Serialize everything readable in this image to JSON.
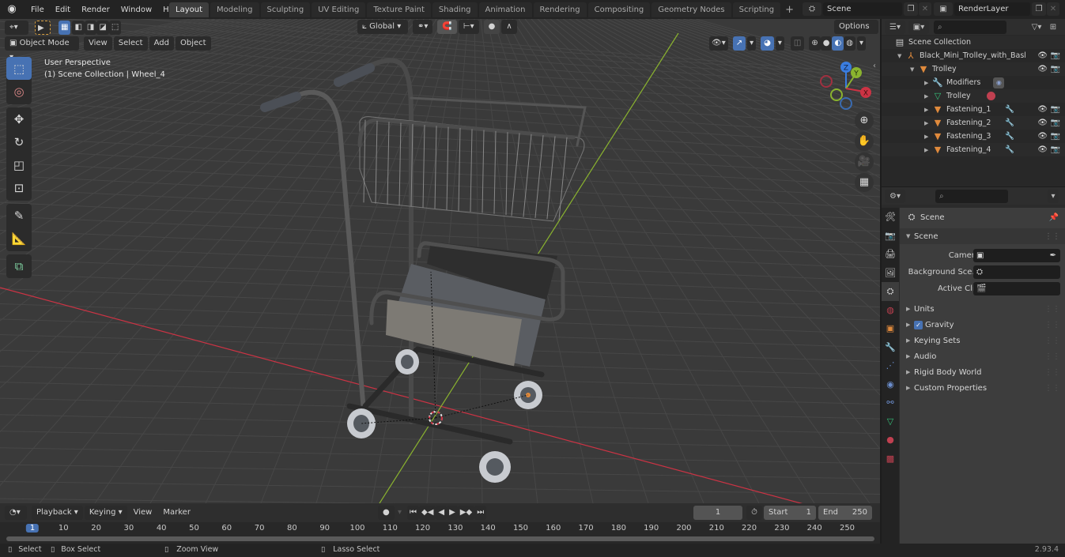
{
  "app": {
    "version": "2.93.4"
  },
  "menu": {
    "logo_icon": "blender-logo-icon",
    "items": [
      "File",
      "Edit",
      "Render",
      "Window",
      "Help"
    ]
  },
  "workspaces": {
    "tabs": [
      "Layout",
      "Modeling",
      "Sculpting",
      "UV Editing",
      "Texture Paint",
      "Shading",
      "Animation",
      "Rendering",
      "Compositing",
      "Geometry Nodes",
      "Scripting"
    ],
    "active": "Layout",
    "add_label": "+"
  },
  "scene_selector": {
    "value": "Scene"
  },
  "view_layer_selector": {
    "value": "RenderLayer"
  },
  "viewport": {
    "mode": "Object Mode",
    "menus": [
      "View",
      "Select",
      "Add",
      "Object"
    ],
    "transform_orientation": "Global",
    "options_label": "Options",
    "overlay_text": {
      "line1": "User Perspective",
      "line2": "(1) Scene Collection | Wheel_4"
    },
    "gizmo_axes": [
      "X",
      "Y",
      "Z"
    ],
    "tools": [
      "select-box",
      "cursor",
      "move",
      "rotate",
      "scale",
      "transform",
      "annotate",
      "measure",
      "add-cube"
    ],
    "nav_buttons": [
      "zoom",
      "pan",
      "camera",
      "ortho-grid"
    ],
    "shading_active": "solid-material-preview"
  },
  "outliner": {
    "search_placeholder": "",
    "root": "Scene Collection",
    "rows": [
      {
        "label": "Black_Mini_Trolley_with_Basl",
        "type": "empty",
        "level": 1,
        "expanded": true,
        "visible": true
      },
      {
        "label": "Trolley",
        "type": "mesh-object",
        "level": 2,
        "expanded": true,
        "visible": true
      },
      {
        "label": "Modifiers",
        "type": "modifiers",
        "level": 3,
        "expanded": false
      },
      {
        "label": "Trolley",
        "type": "mesh-data",
        "level": 3,
        "expanded": false
      },
      {
        "label": "Fastening_1",
        "type": "mesh-object",
        "level": 3,
        "expanded": false,
        "visible": true
      },
      {
        "label": "Fastening_2",
        "type": "mesh-object",
        "level": 3,
        "expanded": false,
        "visible": true
      },
      {
        "label": "Fastening_3",
        "type": "mesh-object",
        "level": 3,
        "expanded": false,
        "visible": true
      },
      {
        "label": "Fastening_4",
        "type": "mesh-object",
        "level": 3,
        "expanded": false,
        "visible": true
      }
    ]
  },
  "properties": {
    "context_title": "Scene",
    "panel_title": "Scene",
    "fields": [
      {
        "label": "Camera",
        "value": ""
      },
      {
        "label": "Background Sce...",
        "value": ""
      },
      {
        "label": "Active Clip",
        "value": ""
      }
    ],
    "sections": [
      {
        "label": "Units"
      },
      {
        "label": "Gravity",
        "checked": true
      },
      {
        "label": "Keying Sets"
      },
      {
        "label": "Audio"
      },
      {
        "label": "Rigid Body World"
      },
      {
        "label": "Custom Properties"
      }
    ],
    "tabs": [
      "tool",
      "render",
      "output",
      "view-layer",
      "scene",
      "world",
      "object",
      "modifiers",
      "particles",
      "physics",
      "constraints",
      "data",
      "material",
      "texture"
    ],
    "active_tab": "scene"
  },
  "timeline": {
    "menus": [
      "Playback",
      "Keying",
      "View",
      "Marker"
    ],
    "current_frame": "1",
    "start_label": "Start",
    "start": "1",
    "end_label": "End",
    "end": "250",
    "ticks": [
      "1",
      "10",
      "20",
      "30",
      "40",
      "50",
      "60",
      "70",
      "80",
      "90",
      "100",
      "110",
      "120",
      "130",
      "140",
      "150",
      "160",
      "170",
      "180",
      "190",
      "200",
      "210",
      "220",
      "230",
      "240",
      "250"
    ]
  },
  "statusbar": {
    "items": [
      "Select",
      "Box Select",
      "Zoom View",
      "Lasso Select"
    ]
  },
  "colors": {
    "accent": "#4772b3",
    "x_axis": "#cc3344",
    "y_axis": "#8ab32f",
    "z_axis": "#3a7de0",
    "object_orange": "#e08a3c"
  }
}
